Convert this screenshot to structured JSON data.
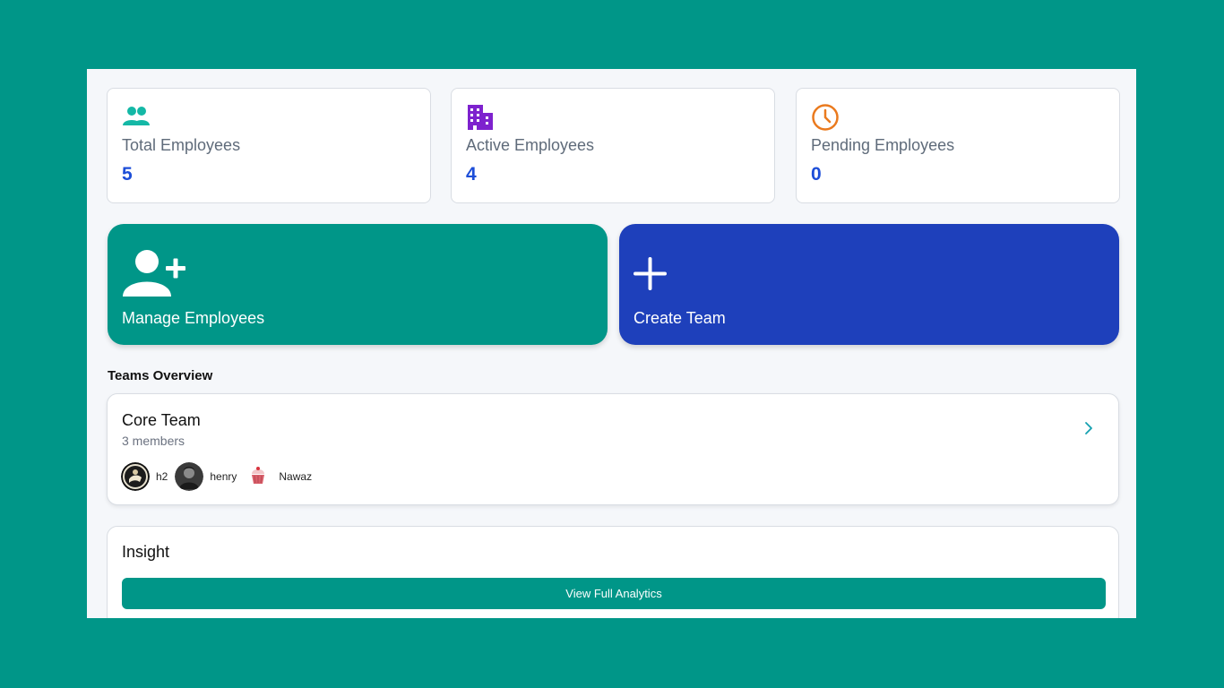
{
  "stats": [
    {
      "label": "Total Employees",
      "value": "5",
      "icon": "users-icon",
      "color": "#14b8a6"
    },
    {
      "label": "Active Employees",
      "value": "4",
      "icon": "building-icon",
      "color": "#7e22ce"
    },
    {
      "label": "Pending Employees",
      "value": "0",
      "icon": "clock-icon",
      "color": "#ea7a1e"
    }
  ],
  "actions": {
    "manage": {
      "label": "Manage Employees",
      "icon": "user-plus-icon",
      "color": "#009688"
    },
    "create": {
      "label": "Create Team",
      "icon": "plus-icon",
      "color": "#1e40bb"
    }
  },
  "teams_section": {
    "title": "Teams Overview",
    "teams": [
      {
        "name": "Core Team",
        "members_count": "3 members",
        "members": [
          {
            "name": "h2",
            "avatar": "avatar-dark-figure"
          },
          {
            "name": "henry",
            "avatar": "avatar-grayscale-photo"
          },
          {
            "name": "Nawaz",
            "avatar": "avatar-cupcake"
          }
        ]
      }
    ]
  },
  "insight": {
    "title": "Insight",
    "button_label": "View Full Analytics"
  },
  "colors": {
    "background": "#009688",
    "accent_blue": "#1d4ed8",
    "create_card": "#1e40bb"
  }
}
